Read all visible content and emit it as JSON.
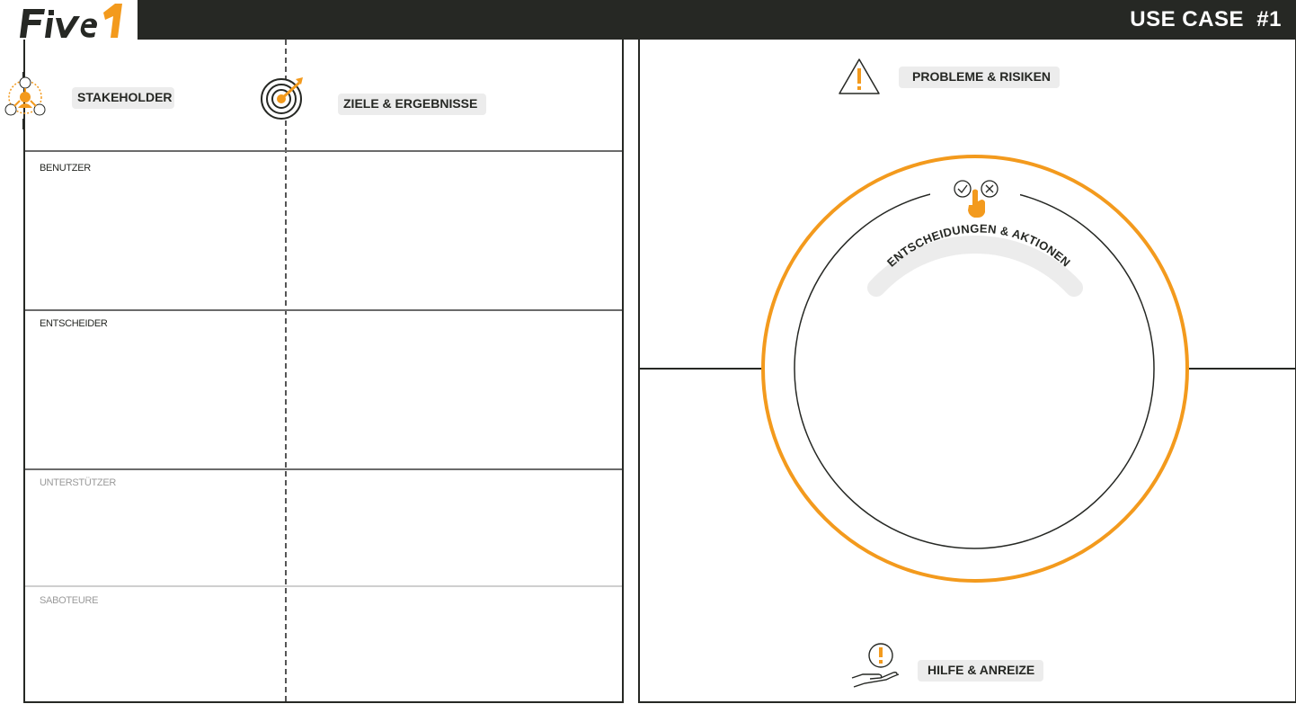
{
  "header": {
    "logo": "FiVe1",
    "title": "USE CASE  #1"
  },
  "left": {
    "stakeholder_label": "STAKEHOLDER",
    "goals_label": "ZIELE & ERGEBNISSE",
    "rows": [
      {
        "label": "BENUTZER"
      },
      {
        "label": "ENTSCHEIDER"
      },
      {
        "label": "UNTERSTÜTZER"
      },
      {
        "label": "SABOTEURE"
      }
    ]
  },
  "right": {
    "problems_label": "PROBLEME & RISIKEN",
    "decisions_label": "ENTSCHEIDUNGEN & AKTIONEN",
    "help_label": "HILFE & ANREIZE"
  },
  "colors": {
    "accent": "#f39a1d",
    "dark": "#262824"
  }
}
